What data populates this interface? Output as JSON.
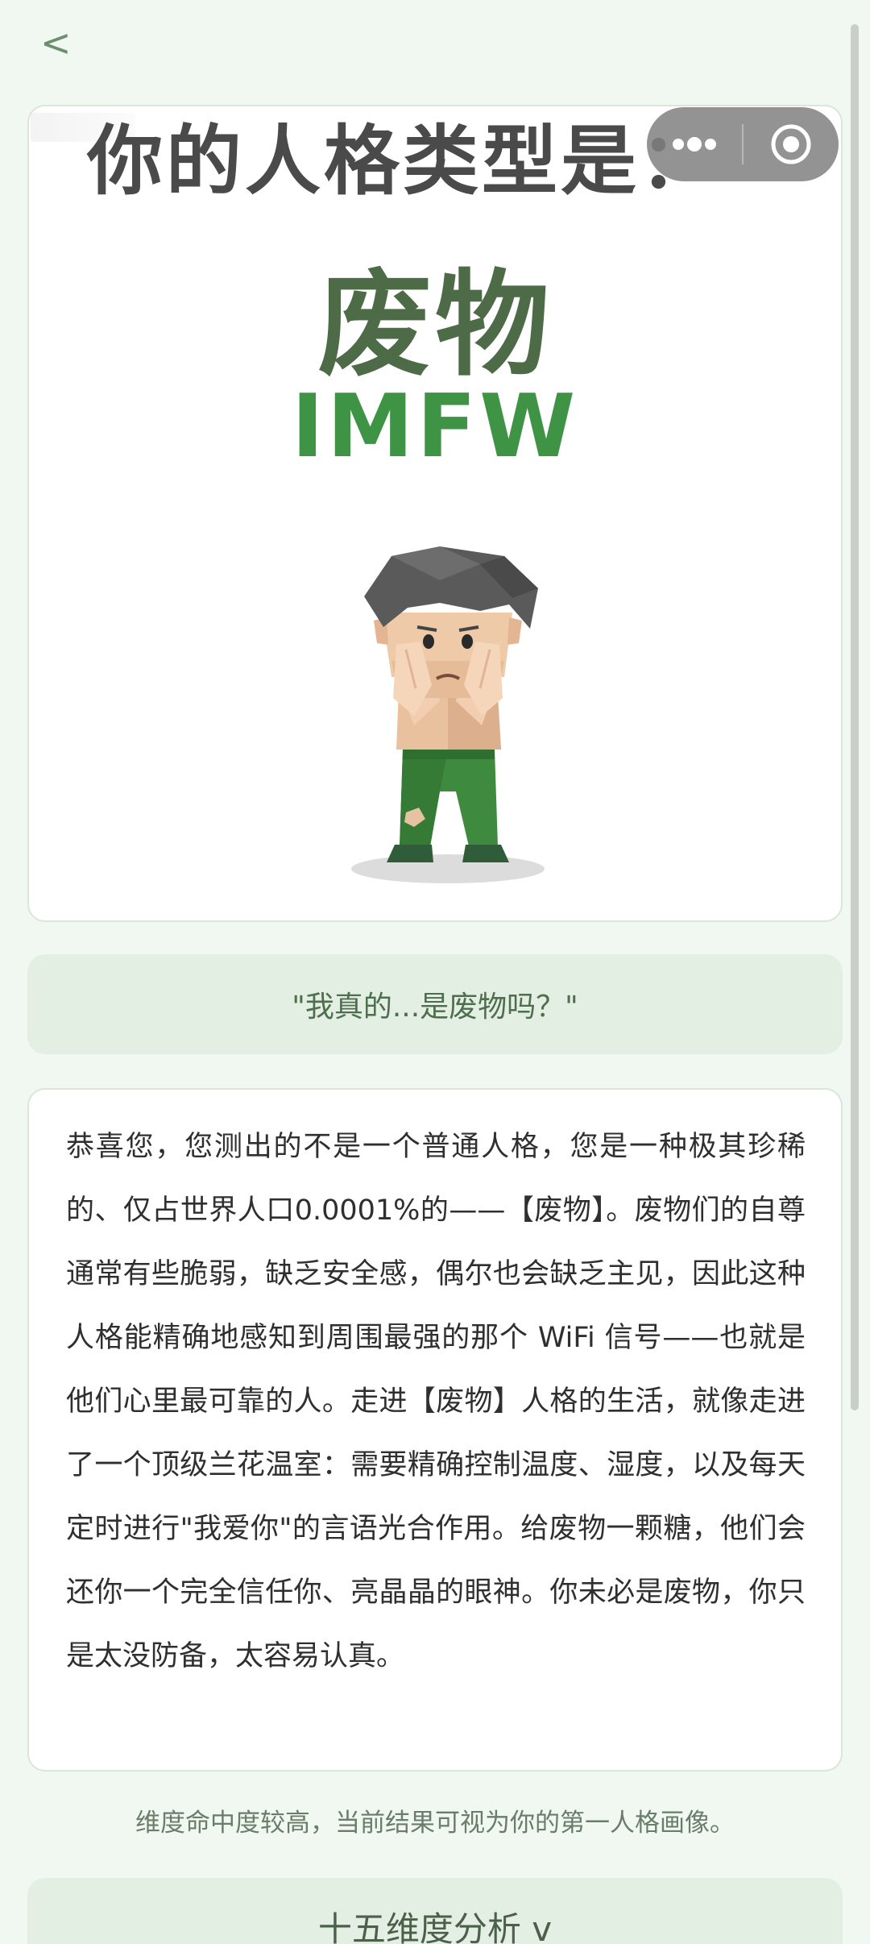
{
  "nav": {
    "back_label": "<"
  },
  "result": {
    "header": "你的人格类型是：",
    "type_name": "废物",
    "type_code": "IMFW"
  },
  "capsule": {
    "more_icon": "more-dots-icon",
    "close_icon": "target-close-icon"
  },
  "quote": "\"我真的...是废物吗？\"",
  "description": "恭喜您，您测出的不是一个普通人格，您是一种极其珍稀的、仅占世界人口0.0001%的——【废物】。废物们的自尊通常有些脆弱，缺乏安全感，偶尔也会缺乏主见，因此这种人格能精确地感知到周围最强的那个 WiFi 信号——也就是他们心里最可靠的人。走进【废物】人格的生活，就像走进了一个顶级兰花温室：需要精确控制温度、湿度，以及每天定时进行\"我爱你\"的言语光合作用。给废物一颗糖，他们会还你一个完全信任你、亮晶晶的眼神。你未必是废物，你只是太没防备，太容易认真。",
  "note": "维度命中度较高，当前结果可视为你的第一人格画像。",
  "dimension_toggle": "十五维度分析 v",
  "colors": {
    "background": "#f1f7f1",
    "accent_green": "#3e9444",
    "name_green": "#4d6b47",
    "panel_green": "#e4efe4"
  }
}
